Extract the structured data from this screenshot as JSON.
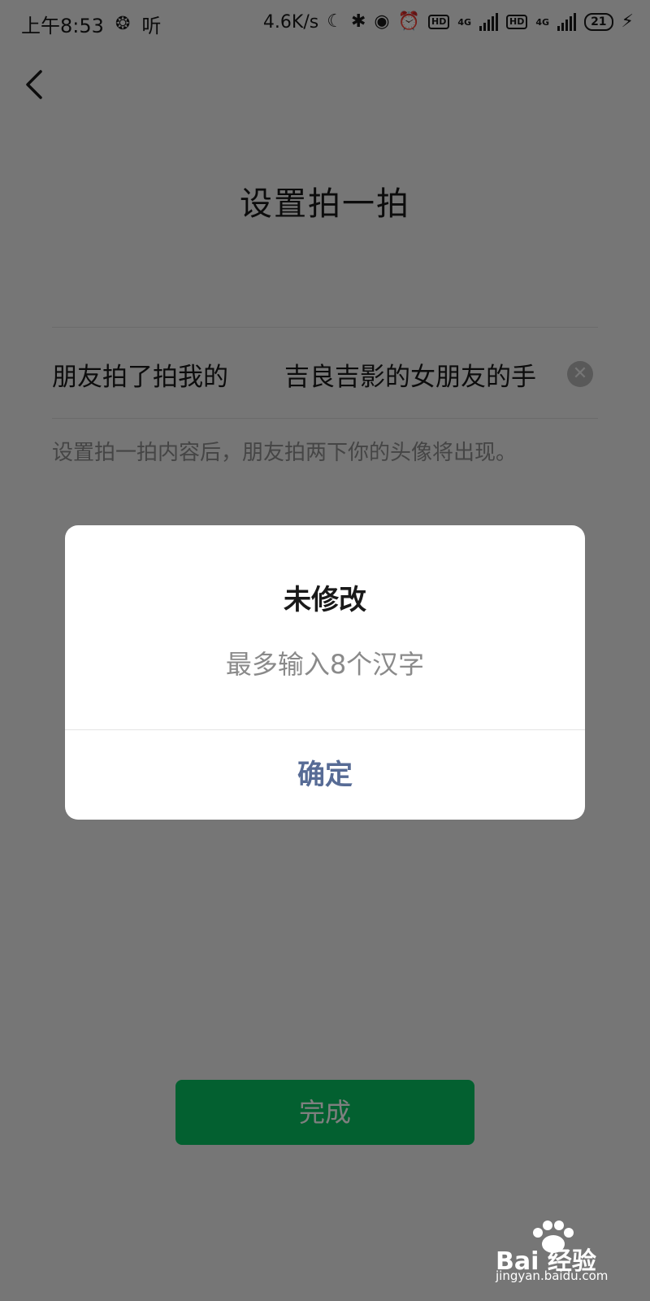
{
  "status_bar": {
    "time": "上午8:53",
    "listen_label": "听",
    "net_speed": "4.6K/s",
    "signal_1": "4G",
    "signal_2": "4G",
    "hd_label": "HD",
    "battery": "21"
  },
  "page": {
    "title": "设置拍一拍",
    "field_prefix": "朋友拍了拍我的",
    "field_value": "吉良吉影的女朋友的手",
    "hint": "设置拍一拍内容后，朋友拍两下你的头像将出现。",
    "done_label": "完成"
  },
  "dialog": {
    "title": "未修改",
    "message": "最多输入8个汉字",
    "confirm_label": "确定"
  },
  "watermark": {
    "brand": "Bai  经验",
    "url": "jingyan.baidu.com"
  },
  "colors": {
    "accent_green": "#07c160",
    "link_blue": "#576b95",
    "background": "#ededed"
  }
}
